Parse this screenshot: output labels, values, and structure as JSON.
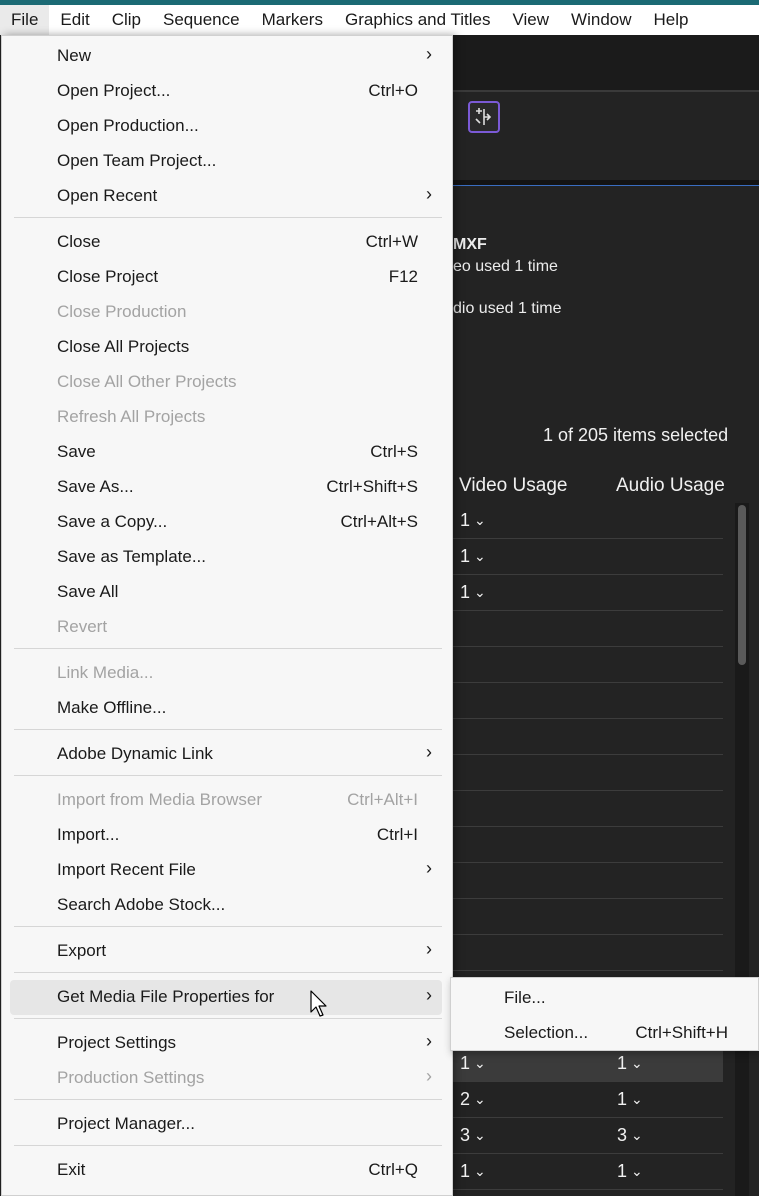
{
  "menubar": [
    "File",
    "Edit",
    "Clip",
    "Sequence",
    "Markers",
    "Graphics and Titles",
    "View",
    "Window",
    "Help"
  ],
  "background": {
    "info_lines": [
      "MXF",
      "eo used 1 time",
      "dio used 1 time"
    ],
    "selection_status": "1 of 205 items selected",
    "columns": [
      "Video Usage",
      "Audio Usage"
    ],
    "rows_top": [
      {
        "video": "1",
        "audio": ""
      },
      {
        "video": "1",
        "audio": ""
      },
      {
        "video": "1",
        "audio": ""
      }
    ],
    "rows_bottom": [
      {
        "video": "1",
        "audio": "1"
      },
      {
        "video": "2",
        "audio": "1"
      },
      {
        "video": "3",
        "audio": "3"
      },
      {
        "video": "1",
        "audio": "1"
      }
    ],
    "chevron": "⌄"
  },
  "file_menu": {
    "new": {
      "label": "New"
    },
    "open_project": {
      "label": "Open Project...",
      "shortcut": "Ctrl+O"
    },
    "open_production": {
      "label": "Open Production..."
    },
    "open_team_project": {
      "label": "Open Team Project..."
    },
    "open_recent": {
      "label": "Open Recent"
    },
    "close": {
      "label": "Close",
      "shortcut": "Ctrl+W"
    },
    "close_project": {
      "label": "Close Project",
      "shortcut": "F12"
    },
    "close_production": {
      "label": "Close Production"
    },
    "close_all_projects": {
      "label": "Close All Projects"
    },
    "close_all_other_projects": {
      "label": "Close All Other Projects"
    },
    "refresh_all_projects": {
      "label": "Refresh All Projects"
    },
    "save": {
      "label": "Save",
      "shortcut": "Ctrl+S"
    },
    "save_as": {
      "label": "Save As...",
      "shortcut": "Ctrl+Shift+S"
    },
    "save_copy": {
      "label": "Save a Copy...",
      "shortcut": "Ctrl+Alt+S"
    },
    "save_template": {
      "label": "Save as Template..."
    },
    "save_all": {
      "label": "Save All"
    },
    "revert": {
      "label": "Revert"
    },
    "link_media": {
      "label": "Link Media..."
    },
    "make_offline": {
      "label": "Make Offline..."
    },
    "dynamic_link": {
      "label": "Adobe Dynamic Link"
    },
    "import_media_browser": {
      "label": "Import from Media Browser",
      "shortcut": "Ctrl+Alt+I"
    },
    "import": {
      "label": "Import...",
      "shortcut": "Ctrl+I"
    },
    "import_recent": {
      "label": "Import Recent File"
    },
    "search_stock": {
      "label": "Search Adobe Stock..."
    },
    "export": {
      "label": "Export"
    },
    "media_props": {
      "label": "Get Media File Properties for"
    },
    "project_settings": {
      "label": "Project Settings"
    },
    "production_settings": {
      "label": "Production Settings"
    },
    "project_manager": {
      "label": "Project Manager..."
    },
    "exit": {
      "label": "Exit",
      "shortcut": "Ctrl+Q"
    },
    "arrow": "›"
  },
  "submenu": {
    "file": {
      "label": "File..."
    },
    "selection": {
      "label": "Selection...",
      "shortcut": "Ctrl+Shift+H"
    }
  }
}
